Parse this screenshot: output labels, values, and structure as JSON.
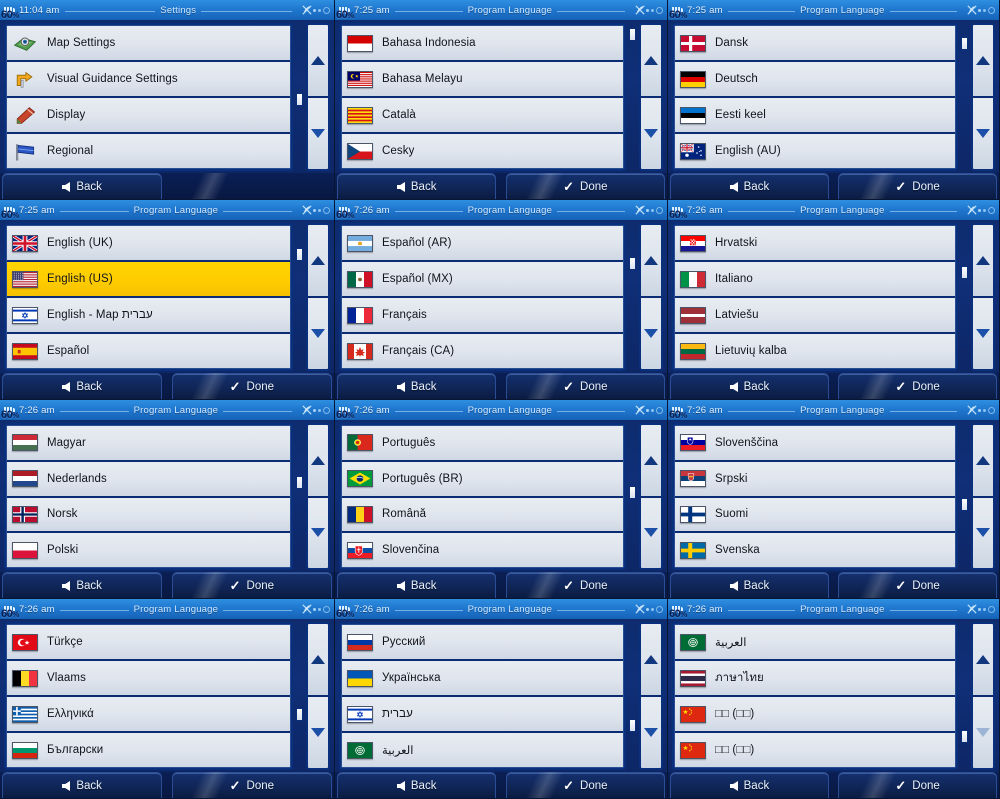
{
  "meta": {
    "watermark": "60",
    "watermark_suffix": "%",
    "grid": {
      "cols": 3,
      "rows": 4
    }
  },
  "labels": {
    "back": "Back",
    "done": "Done",
    "back_icon": "arrow-left-icon",
    "done_icon": "checkmark-icon",
    "scroll_up_icon": "triangle-up-icon",
    "scroll_down_icon": "triangle-down-icon",
    "satellite_icon": "satellite-off-icon",
    "battery_icon": "battery-icon",
    "gear_icon": "gear-icon"
  },
  "panels": [
    {
      "time": "11:04 am",
      "title": "Settings",
      "selected_index": -1,
      "scroll_pos": 0.62,
      "down_dim": false,
      "show_done": false,
      "items": [
        {
          "label": "Map Settings",
          "icon": "map-settings-icon",
          "type": "icon"
        },
        {
          "label": "Visual Guidance Settings",
          "icon": "visual-guidance-icon",
          "type": "icon"
        },
        {
          "label": "Display",
          "icon": "display-icon",
          "type": "icon"
        },
        {
          "label": "Regional",
          "icon": "regional-flag-icon",
          "type": "icon"
        }
      ]
    },
    {
      "time": "7:25 am",
      "title": "Program Language",
      "selected_index": -1,
      "scroll_pos": 0.04,
      "down_dim": false,
      "show_done": true,
      "items": [
        {
          "label": "Bahasa Indonesia",
          "flag": "id"
        },
        {
          "label": "Bahasa Melayu",
          "flag": "my"
        },
        {
          "label": "Català",
          "flag": "catalonia"
        },
        {
          "label": "Česky",
          "flag": "cz"
        }
      ]
    },
    {
      "time": "7:25 am",
      "title": "Program Language",
      "selected_index": -1,
      "scroll_pos": 0.12,
      "down_dim": false,
      "show_done": true,
      "items": [
        {
          "label": "Dansk",
          "flag": "dk"
        },
        {
          "label": "Deutsch",
          "flag": "de"
        },
        {
          "label": "Eesti keel",
          "flag": "ee"
        },
        {
          "label": "English (AU)",
          "flag": "au"
        }
      ]
    },
    {
      "time": "7:25 am",
      "title": "Program Language",
      "selected_index": 1,
      "scroll_pos": 0.22,
      "down_dim": false,
      "show_done": true,
      "items": [
        {
          "label": "English (UK)",
          "flag": "gb"
        },
        {
          "label": "English (US)",
          "flag": "us"
        },
        {
          "label": "English - Map עברית",
          "flag": "il"
        },
        {
          "label": "Español",
          "flag": "es"
        }
      ]
    },
    {
      "time": "7:26 am",
      "title": "Program Language",
      "selected_index": -1,
      "scroll_pos": 0.3,
      "down_dim": false,
      "show_done": true,
      "items": [
        {
          "label": "Español (AR)",
          "flag": "ar"
        },
        {
          "label": "Español (MX)",
          "flag": "mx"
        },
        {
          "label": "Français",
          "flag": "fr"
        },
        {
          "label": "Français (CA)",
          "flag": "ca"
        }
      ]
    },
    {
      "time": "7:26 am",
      "title": "Program Language",
      "selected_index": -1,
      "scroll_pos": 0.38,
      "down_dim": false,
      "show_done": true,
      "items": [
        {
          "label": "Hrvatski",
          "flag": "hr"
        },
        {
          "label": "Italiano",
          "flag": "it"
        },
        {
          "label": "Latviešu",
          "flag": "lv"
        },
        {
          "label": "Lietuvių kalba",
          "flag": "lt"
        }
      ]
    },
    {
      "time": "7:26 am",
      "title": "Program Language",
      "selected_index": -1,
      "scroll_pos": 0.47,
      "down_dim": false,
      "show_done": true,
      "items": [
        {
          "label": "Magyar",
          "flag": "hu"
        },
        {
          "label": "Nederlands",
          "flag": "nl"
        },
        {
          "label": "Norsk",
          "flag": "no"
        },
        {
          "label": "Polski",
          "flag": "pl"
        }
      ]
    },
    {
      "time": "7:26 am",
      "title": "Program Language",
      "selected_index": -1,
      "scroll_pos": 0.56,
      "down_dim": false,
      "show_done": true,
      "items": [
        {
          "label": "Português",
          "flag": "pt"
        },
        {
          "label": "Português (BR)",
          "flag": "br"
        },
        {
          "label": "Română",
          "flag": "ro"
        },
        {
          "label": "Slovenčina",
          "flag": "sk"
        }
      ]
    },
    {
      "time": "7:26 am",
      "title": "Program Language",
      "selected_index": -1,
      "scroll_pos": 0.66,
      "down_dim": false,
      "show_done": true,
      "items": [
        {
          "label": "Slovenščina",
          "flag": "si"
        },
        {
          "label": "Srpski",
          "flag": "rs"
        },
        {
          "label": "Suomi",
          "flag": "fi"
        },
        {
          "label": "Svenska",
          "flag": "se"
        }
      ]
    },
    {
      "time": "7:26 am",
      "title": "Program Language",
      "selected_index": -1,
      "scroll_pos": 0.76,
      "down_dim": false,
      "show_done": true,
      "items": [
        {
          "label": "Türkçe",
          "flag": "tr"
        },
        {
          "label": "Vlaams",
          "flag": "be"
        },
        {
          "label": "Ελληνικά",
          "flag": "gr"
        },
        {
          "label": "Български",
          "flag": "bg"
        }
      ]
    },
    {
      "time": "7:26 am",
      "title": "Program Language",
      "selected_index": -1,
      "scroll_pos": 0.86,
      "down_dim": false,
      "show_done": true,
      "items": [
        {
          "label": "Русский",
          "flag": "ru"
        },
        {
          "label": "Українська",
          "flag": "ua"
        },
        {
          "label": "עברית",
          "flag": "il",
          "rtl": true
        },
        {
          "label": "العربية",
          "flag": "sa",
          "rtl": true
        }
      ]
    },
    {
      "time": "7:26 am",
      "title": "Program Language",
      "selected_index": -1,
      "scroll_pos": 0.96,
      "down_dim": true,
      "show_done": true,
      "items": [
        {
          "label": "العربية",
          "flag": "sa",
          "rtl": true
        },
        {
          "label": "ภาษาไทย",
          "flag": "th"
        },
        {
          "label": "□□ (□□)",
          "flag": "cn"
        },
        {
          "label": "□□ (□□)",
          "flag": "cn"
        }
      ]
    }
  ],
  "colors": {
    "titlebar": "#2078cf",
    "panel_bg": "#102f78",
    "row_bg": "#dfe5ee",
    "row_selected": "#ffcc00",
    "footer_btn": "#102657",
    "text_dark": "#10131a",
    "text_light": "#dff1ff"
  }
}
